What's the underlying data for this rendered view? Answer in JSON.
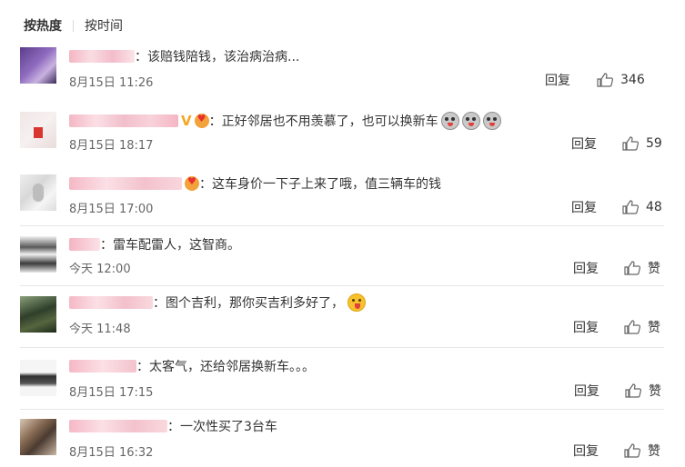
{
  "sort": {
    "active": "按热度",
    "other": "按时间"
  },
  "comments": [
    {
      "text": "该赔钱陪钱，该治病治病...",
      "time": "8月15日 11:26",
      "reply": "回复",
      "likes": "346"
    },
    {
      "text": "正好邻居也不用羡慕了，也可以换新车",
      "time": "8月15日 18:17",
      "reply": "回复",
      "likes": "59"
    },
    {
      "text": "这车身价一下子上来了哦，值三辆车的钱",
      "time": "8月15日 17:00",
      "reply": "回复",
      "likes": "48"
    },
    {
      "text": "雷车配雷人，这智商。",
      "time": "今天 12:00",
      "reply": "回复",
      "likes": "赞"
    },
    {
      "text": "图个吉利，那你买吉利多好了，",
      "time": "今天 11:48",
      "reply": "回复",
      "likes": "赞"
    },
    {
      "text": "太客气，还给邻居换新车。。。",
      "time": "8月15日 17:15",
      "reply": "回复",
      "likes": "赞"
    },
    {
      "text": "一次性买了3台车",
      "time": "8月15日 16:32",
      "reply": "回复",
      "likes": "赞"
    }
  ],
  "colors": {
    "like_icon": "#666666",
    "username_blur": "#f2c7cf"
  },
  "icons": {
    "like": "thumbs-up-icon"
  }
}
